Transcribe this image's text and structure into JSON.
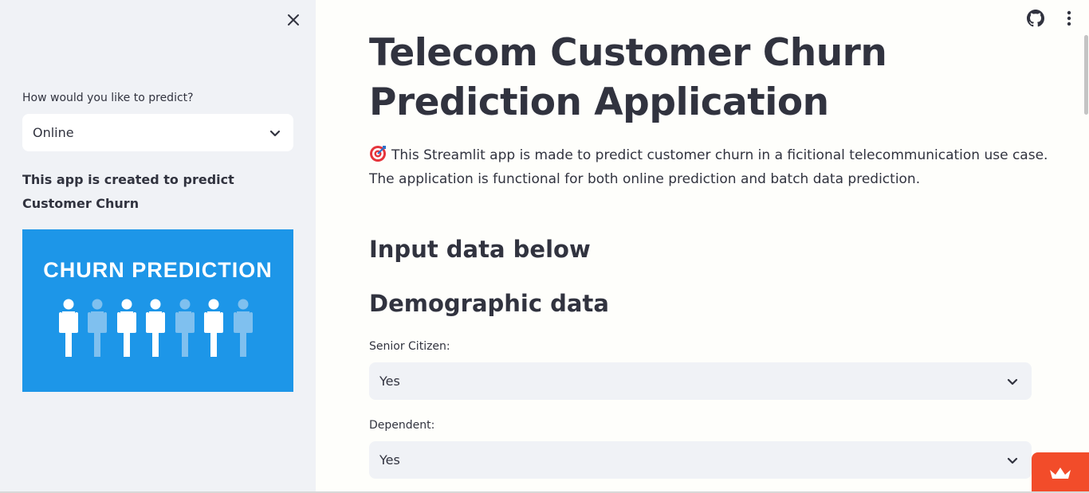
{
  "sidebar": {
    "predict_label": "How would you like to predict?",
    "predict_value": "Online",
    "description": "This app is created to predict Customer Churn",
    "image_text": "CHURN PREDICTION"
  },
  "main": {
    "title": "Telecom Customer Churn Prediction Application",
    "intro": "This Streamlit app is made to predict customer churn in a ficitional telecommunication use case. The application is functional for both online prediction and batch data prediction.",
    "heading_input": "Input data below",
    "heading_demographic": "Demographic data",
    "fields": [
      {
        "label": "Senior Citizen:",
        "value": "Yes"
      },
      {
        "label": "Dependent:",
        "value": "Yes"
      }
    ]
  },
  "icons": {
    "close": "close-icon",
    "chevron": "chevron-down-icon",
    "github": "github-icon",
    "menu": "kebab-menu-icon",
    "target": "target-emoji-icon",
    "crown": "crown-icon"
  },
  "colors": {
    "sidebar_bg": "#f0f2f6",
    "main_bg": "#fefefb",
    "text": "#31333f",
    "image_bg": "#1d96e8",
    "badge": "#f24c2a"
  }
}
